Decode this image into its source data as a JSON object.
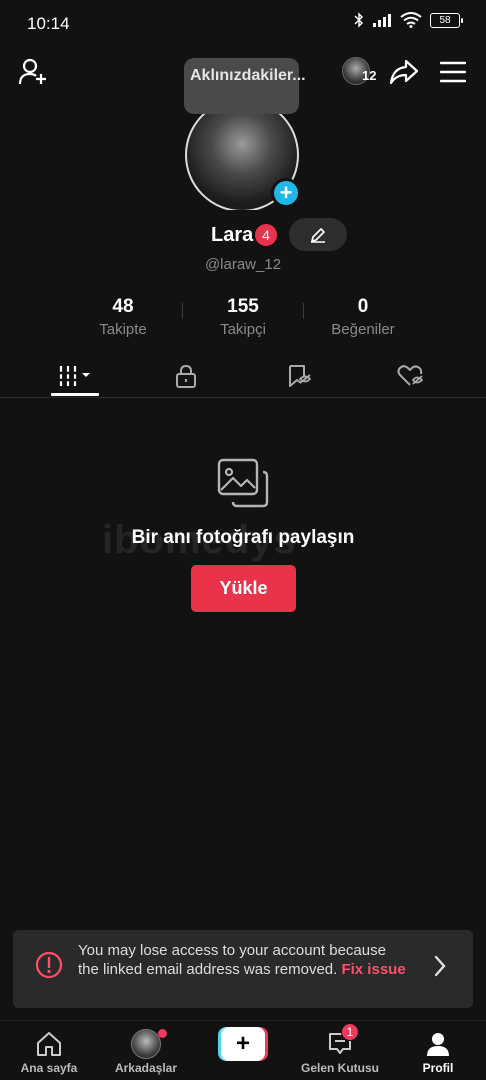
{
  "status_bar": {
    "time": "10:14",
    "battery": "58"
  },
  "header": {
    "story_count": "12"
  },
  "tooltip": {
    "text": "Aklınızdakiler..."
  },
  "profile": {
    "name": "Lara",
    "name_badge": "4",
    "username": "@laraw_12"
  },
  "stats": [
    {
      "value": "48",
      "label": "Takipte"
    },
    {
      "value": "155",
      "label": "Takipçi"
    },
    {
      "value": "0",
      "label": "Beğeniler"
    }
  ],
  "tabs": [
    "videos-grid-icon",
    "lock-icon",
    "tagged-icon",
    "liked-icon"
  ],
  "empty_state": {
    "title": "Bir anı fotoğrafı paylaşın",
    "button": "Yükle"
  },
  "banner": {
    "message": "You may lose access to your account because the linked email address was removed.",
    "action": "Fix issue"
  },
  "bottom_nav": {
    "home": "Ana sayfa",
    "friends": "Arkadaşlar",
    "inbox": "Gelen Kutusu",
    "inbox_badge": "1",
    "profile": "Profil"
  },
  "colors": {
    "accent": "#e8334a",
    "link": "#ff4f6a",
    "teal": "#20b8e8"
  }
}
